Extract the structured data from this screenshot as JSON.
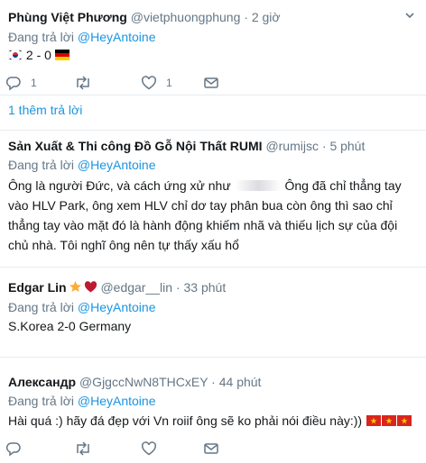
{
  "tweets": [
    {
      "name": "Phùng Việt Phương",
      "handle": "@vietphuongphung",
      "dot": "·",
      "time": "2 giờ",
      "reply_prefix": "Đang trả lời",
      "reply_mention": "@HeyAntoine",
      "score": "2 - 0",
      "actions": {
        "reply_count": "1",
        "retweet_count": "",
        "like_count": "1"
      }
    },
    {
      "name": "Sản Xuất & Thi công Đồ Gỗ Nội Thất RUMI",
      "handle": "@rumijsc",
      "dot": "·",
      "time": "5 phút",
      "reply_prefix": "Đang trả lời",
      "reply_mention": "@HeyAntoine",
      "text_a": "Ông là người Đức, và cách ứng xử như",
      "text_b": "Ông đã chỉ thẳng tay vào HLV Park, ông xem HLV chỉ dơ tay phân bua còn ông thì sao chỉ thẳng tay vào mặt đó là hành động khiếm nhã và thiếu lịch sự của đội chủ nhà. Tôi nghĩ ông nên tự thấy xấu hổ"
    },
    {
      "name": "Edgar Lin",
      "handle": "@edgar__lin",
      "dot": "·",
      "time": "33 phút",
      "reply_prefix": "Đang trả lời",
      "reply_mention": "@HeyAntoine",
      "text": "S.Korea 2-0 Germany"
    },
    {
      "name": "Александр",
      "handle": "@GjgccNwN8THCxEY",
      "dot": "·",
      "time": "44 phút",
      "reply_prefix": "Đang trả lời",
      "reply_mention": "@HeyAntoine",
      "text": "Hài quá :) hãy đá đẹp với Vn roiif ông sẽ ko phải nói điều này:))"
    }
  ],
  "more_replies": "1 thêm trả lời",
  "icons": {
    "reply": "reply-icon",
    "retweet": "retweet-icon",
    "like": "heart-icon",
    "dm": "envelope-icon",
    "menu": "chevron-down-icon",
    "flag_kr": "south-korea-flag-emoji",
    "flag_de": "germany-flag-emoji",
    "flag_vn": "vietnam-flag-emoji",
    "star": "star-emoji",
    "heart": "red-heart-emoji"
  },
  "colors": {
    "link": "#1b95e0",
    "muted": "#657786",
    "text": "#14171a",
    "separator": "#e6ecf0"
  }
}
